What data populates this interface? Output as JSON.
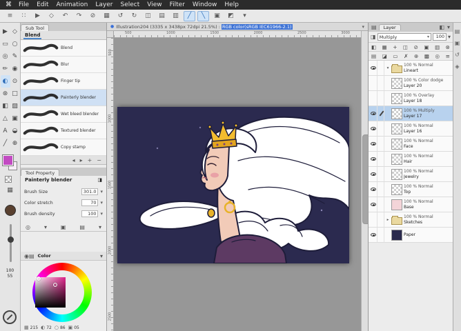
{
  "ui": {
    "caret_down": "▾",
    "caret_right": "▸",
    "dot": "●"
  },
  "colors": {
    "selection": "#b8d2ee",
    "accent": "#3f74d6",
    "canvas_navy": "#2b2a4f"
  },
  "menu_bar": {
    "apple": "⌘",
    "items": [
      "File",
      "Edit",
      "Animation",
      "Layer",
      "Select",
      "View",
      "Filter",
      "Window",
      "Help"
    ]
  },
  "toolbar": {
    "icons": [
      {
        "name": "palette-menu-icon",
        "glyph": "≡"
      },
      {
        "name": "dot-grid-icon",
        "glyph": "∷"
      },
      {
        "name": "pointer-icon",
        "glyph": "▶"
      },
      {
        "name": "hand-icon",
        "glyph": "◇"
      },
      {
        "name": "undo-icon",
        "glyph": "↶"
      },
      {
        "name": "redo-icon",
        "glyph": "↷"
      },
      {
        "name": "clear-icon",
        "glyph": "⊘"
      },
      {
        "name": "fit-screen-icon",
        "glyph": "▦"
      },
      {
        "name": "rotate-left-icon",
        "glyph": "↺"
      },
      {
        "name": "rotate-right-icon",
        "glyph": "↻"
      },
      {
        "name": "flip-horizontal-icon",
        "glyph": "◫"
      },
      {
        "name": "grid-icon",
        "glyph": "▤"
      },
      {
        "name": "snap-ruler-icon",
        "glyph": "▥"
      },
      {
        "name": "snap-line-icon",
        "glyph": "╱",
        "active": true
      },
      {
        "name": "snap-curve-icon",
        "glyph": "╲",
        "active": true
      },
      {
        "name": "material-icon",
        "glyph": "▣"
      },
      {
        "name": "mask-view-icon",
        "glyph": "◩"
      },
      {
        "name": "toolbar-overflow-icon",
        "glyph": "▾"
      }
    ]
  },
  "doc_tab": {
    "title_plain": "Illustration204 (3335 x 3438px 72dpi 21.5%) : ",
    "title_highlight": "RGB color(sRGB IEC61966-2.1)"
  },
  "tool_palette": {
    "tools": [
      {
        "name": "object-tool",
        "glyph": "▶"
      },
      {
        "name": "move-tool",
        "glyph": "◇"
      },
      {
        "name": "marquee-tool",
        "glyph": "▭"
      },
      {
        "name": "lasso-tool",
        "glyph": "○"
      },
      {
        "name": "eyedropper-tool",
        "glyph": "◎"
      },
      {
        "name": "pen-tool",
        "glyph": "✎"
      },
      {
        "name": "pencil-tool",
        "glyph": "✏"
      },
      {
        "name": "brush-tool",
        "glyph": "◉"
      },
      {
        "name": "blend-tool",
        "glyph": "◐",
        "active": true
      },
      {
        "name": "airbrush-tool",
        "glyph": "⊙"
      },
      {
        "name": "decoration-tool",
        "glyph": "⊛"
      },
      {
        "name": "eraser-tool",
        "glyph": "□"
      },
      {
        "name": "fill-tool",
        "glyph": "◧"
      },
      {
        "name": "gradient-tool",
        "glyph": "▨"
      },
      {
        "name": "figure-tool",
        "glyph": "△"
      },
      {
        "name": "frame-tool",
        "glyph": "▣"
      },
      {
        "name": "text-tool",
        "glyph": "A"
      },
      {
        "name": "balloon-tool",
        "glyph": "◒"
      },
      {
        "name": "correction-tool",
        "glyph": "╱"
      },
      {
        "name": "operation-tool",
        "glyph": "⊕"
      }
    ]
  },
  "swatches": {
    "primary": "#c24bc2",
    "secondary": "#f6eef6",
    "zoom_readout": "100",
    "sub_readout": "55"
  },
  "subtool_panel": {
    "tab": "Sub Tool",
    "group": "Blend",
    "items": [
      {
        "label": "Blend"
      },
      {
        "label": "Blur"
      },
      {
        "label": "Finger tip"
      },
      {
        "label": "Painterly blender",
        "selected": true
      },
      {
        "label": "Wet bleed blender"
      },
      {
        "label": "Textured blender"
      },
      {
        "label": "Copy stamp"
      }
    ],
    "footer_icons": [
      {
        "name": "prev-icon",
        "glyph": "◂"
      },
      {
        "name": "next-icon",
        "glyph": "▸"
      },
      {
        "name": "add-subtool-icon",
        "glyph": "+"
      },
      {
        "name": "delete-subtool-icon",
        "glyph": "−"
      }
    ]
  },
  "tool_property": {
    "tab": "Tool Property",
    "subtool_name": "Painterly blender",
    "wrench_icon": "◨",
    "props": [
      {
        "label": "Brush Size",
        "value": "301.0"
      },
      {
        "label": "Color stretch",
        "value": "70"
      },
      {
        "label": "Brush density",
        "value": "100"
      }
    ],
    "footer_icons": [
      {
        "name": "preset-icon",
        "glyph": "◎"
      },
      {
        "name": "collapse-icon",
        "glyph": "▾"
      },
      {
        "name": "detail-panel-icon",
        "glyph": "▣"
      },
      {
        "name": "all-settings-icon",
        "glyph": "▤"
      },
      {
        "name": "more-icon",
        "glyph": "▾"
      }
    ]
  },
  "color_panel": {
    "label": "Color",
    "header_icons": [
      {
        "name": "color-wheel-tab-icon",
        "glyph": "◉"
      },
      {
        "name": "color-set-tab-icon",
        "glyph": "▤"
      }
    ],
    "values": [
      {
        "name": "color-value-1",
        "glyph": "▦",
        "value": "215"
      },
      {
        "name": "color-value-2",
        "glyph": "◐",
        "value": "72"
      },
      {
        "name": "color-value-3",
        "glyph": "○",
        "value": "86"
      },
      {
        "name": "color-value-4",
        "glyph": "▣",
        "value": "05"
      }
    ]
  },
  "rulers": {
    "horizontal": [
      "500",
      "1000",
      "1500",
      "2000",
      "2500",
      "3000"
    ],
    "vertical": [
      "500",
      "1000",
      "1500",
      "2000",
      "2500"
    ]
  },
  "layers_panel": {
    "tab": "Layer",
    "tab_icons_left": [
      {
        "name": "layer-palette-menu-icon",
        "glyph": "▤"
      }
    ],
    "tab_icons_right": [
      {
        "name": "dock-icon",
        "glyph": "◧"
      },
      {
        "name": "collapse-panel-icon",
        "glyph": "▾"
      }
    ],
    "mode_icon": "◨",
    "blend_mode": "Multiply",
    "opacity": "100",
    "ops_row1": [
      {
        "name": "blend-through-icon",
        "glyph": "◧"
      },
      {
        "name": "new-raster-layer-icon",
        "glyph": "▦"
      },
      {
        "name": "new-folder-icon",
        "glyph": "+"
      },
      {
        "name": "duplicate-layer-icon",
        "glyph": "◫"
      },
      {
        "name": "clear-layer-icon",
        "glyph": "⊘"
      },
      {
        "name": "layer-mask-icon",
        "glyph": "▣"
      },
      {
        "name": "ruler-layer-icon",
        "glyph": "▥"
      },
      {
        "name": "delete-layer-icon",
        "glyph": "⊗"
      }
    ],
    "ops_row2": [
      {
        "name": "clip-at-layer-icon",
        "glyph": "▤"
      },
      {
        "name": "reference-layer-icon",
        "glyph": "◪"
      },
      {
        "name": "lock-layer-icon",
        "glyph": "▭"
      },
      {
        "name": "lock-alpha-icon",
        "glyph": "✗"
      },
      {
        "name": "draft-layer-icon",
        "glyph": "⊕"
      },
      {
        "name": "layer-color-icon",
        "glyph": "▩"
      },
      {
        "name": "two-pane-icon",
        "glyph": "◎"
      },
      {
        "name": "list-menu-icon",
        "glyph": "≡"
      }
    ],
    "rows": [
      {
        "info": "100 % Normal",
        "name": "Lineart",
        "eye": true,
        "folder": true,
        "arrow": "▾"
      },
      {
        "info": "100 % Color dodge",
        "name": "Layer 20",
        "thumb": "checker",
        "arrow": ""
      },
      {
        "info": "100 % Overlay",
        "name": "Layer 18",
        "thumb": "checker",
        "arrow": ""
      },
      {
        "info": "100 % Multiply",
        "name": "Layer 17",
        "eye": true,
        "editing": true,
        "selected": true,
        "thumb": "checker",
        "arrow": ""
      },
      {
        "info": "100 % Normal",
        "name": "Layer 16",
        "eye": true,
        "thumb": "checker",
        "arrow": ""
      },
      {
        "info": "100 % Normal",
        "name": "Face",
        "eye": true,
        "thumb": "checker",
        "arrow": ""
      },
      {
        "info": "100 % Normal",
        "name": "Hair",
        "eye": true,
        "thumb": "checker",
        "arrow": ""
      },
      {
        "info": "100 % Normal",
        "name": "Jewelry",
        "eye": true,
        "thumb": "checker",
        "arrow": ""
      },
      {
        "info": "100 % Normal",
        "name": "Top",
        "eye": true,
        "thumb": "checker",
        "arrow": ""
      },
      {
        "info": "100 % Normal",
        "name": "Base",
        "eye": true,
        "thumb": "pink",
        "arrow": ""
      },
      {
        "info": "100 % Normal",
        "name": "Sketches",
        "folder": true,
        "arrow": "▸"
      },
      {
        "info": "",
        "name": "Paper",
        "eye": true,
        "thumb": "navy",
        "arrow": ""
      }
    ]
  },
  "right_strip": {
    "icons": [
      {
        "name": "quick-access-panel-icon",
        "glyph": "▤"
      },
      {
        "name": "material-panel-icon",
        "glyph": "▣"
      },
      {
        "name": "history-panel-icon",
        "glyph": "↺"
      },
      {
        "name": "navigator-panel-icon",
        "glyph": "◈"
      }
    ]
  }
}
